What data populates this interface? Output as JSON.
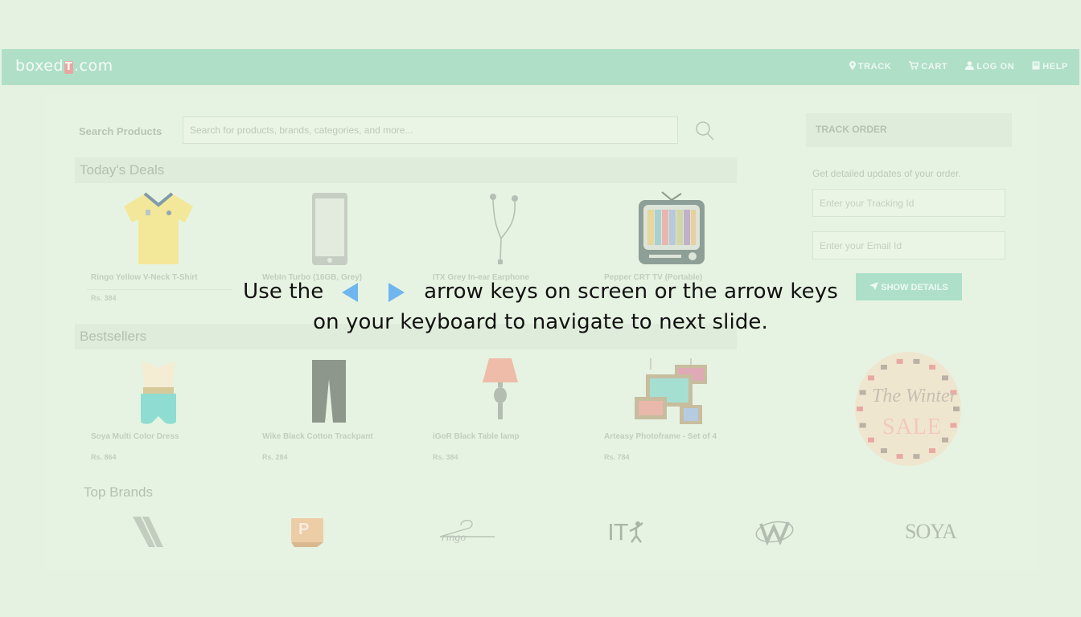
{
  "header": {
    "logo_left": "boxed",
    "logo_mark": "T",
    "logo_right": ".com",
    "nav": [
      {
        "label": "TRACK",
        "icon": "map-pin-icon"
      },
      {
        "label": "CART",
        "icon": "cart-icon"
      },
      {
        "label": "LOG ON",
        "icon": "user-icon"
      },
      {
        "label": "HELP",
        "icon": "book-icon"
      }
    ]
  },
  "search": {
    "label": "Search Products",
    "placeholder": "Search for products, brands, categories, and more..."
  },
  "deals": {
    "title": "Today's Deals",
    "items": [
      {
        "name": "Ringo Yellow V-Neck T-Shirt",
        "price": "Rs. 384",
        "icon": "tshirt-icon"
      },
      {
        "name": "WebIn Turbo (16GB, Grey)",
        "price": "",
        "icon": "phone-icon"
      },
      {
        "name": "ITX Grey In-ear Earphone",
        "price": "",
        "icon": "earphone-icon"
      },
      {
        "name": "Pepper CRT TV (Portable)",
        "price": "",
        "icon": "tv-icon"
      }
    ]
  },
  "bestsellers": {
    "title": "Bestsellers",
    "items": [
      {
        "name": "Soya Multi Color Dress",
        "price": "Rs. 864",
        "icon": "dress-icon"
      },
      {
        "name": "Wike Black Cotton Trackpant",
        "price": "Rs. 284",
        "icon": "trackpant-icon"
      },
      {
        "name": "iGoR Black Table lamp",
        "price": "Rs. 384",
        "icon": "lamp-icon"
      },
      {
        "name": "Arteasy Photoframe - Set of 4",
        "price": "Rs. 784",
        "icon": "photoframe-icon"
      }
    ]
  },
  "brands": {
    "title": "Top Brands",
    "items": [
      "wike-logo",
      "pepper-logo",
      "ringo-logo",
      "itx-logo",
      "webin-logo",
      "soya-logo"
    ],
    "ringo_text": "ringo",
    "itx_text": "IT",
    "soya_text": "SOYA",
    "pepper_text": "P"
  },
  "track": {
    "title": "TRACK ORDER",
    "description": "Get detailed updates of your order.",
    "tracking_placeholder": "Enter your Tracking Id",
    "email_placeholder": "Enter your Email Id",
    "button_label": "SHOW DETAILS"
  },
  "promo": {
    "line1": "The Winter",
    "line2": "SALE"
  },
  "instruction": {
    "part1": "Use the",
    "part2": "arrow keys on screen or the arrow keys",
    "line2": "on your keyboard to navigate to next slide."
  },
  "colors": {
    "background": "#e6f2e1",
    "header": "#b0dfc8",
    "arrow": "#6fb6ee"
  }
}
